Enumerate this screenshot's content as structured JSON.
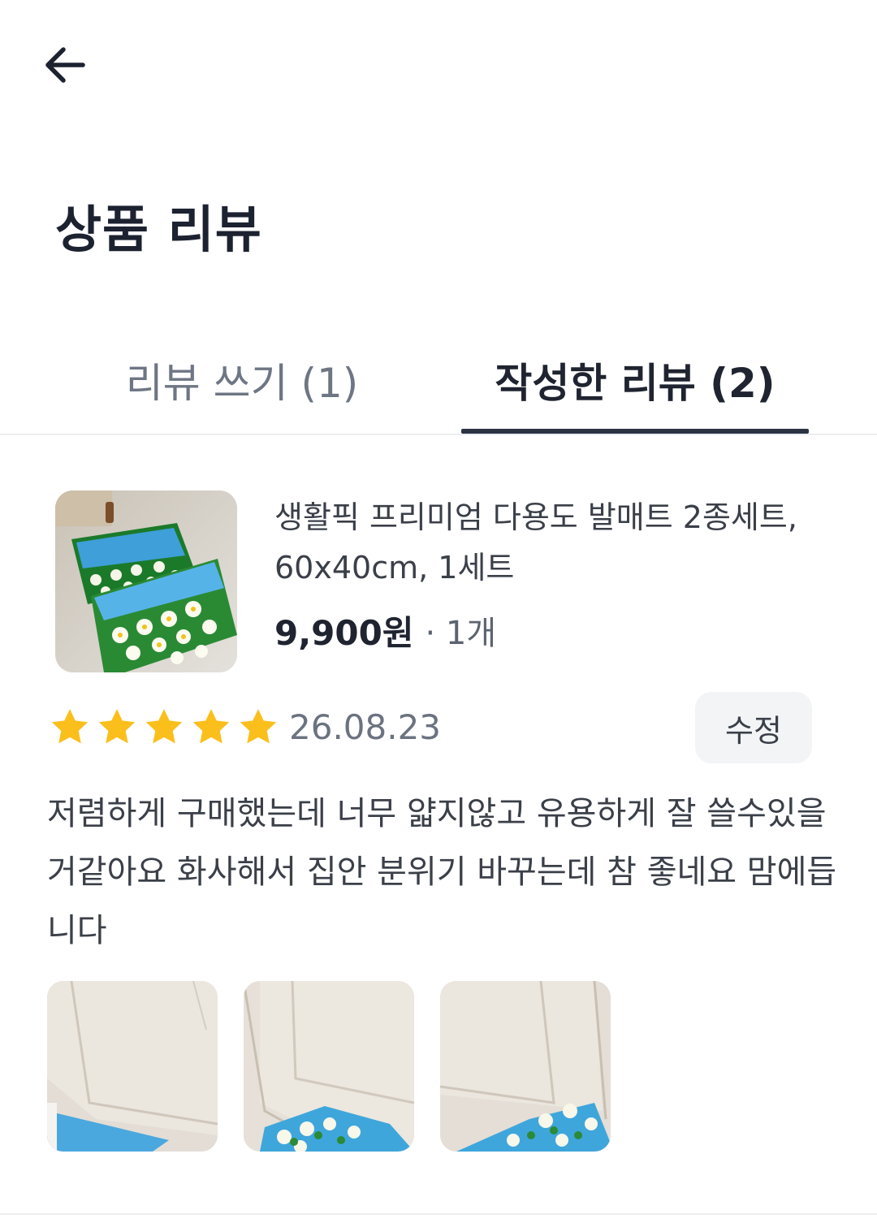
{
  "header": {
    "back_icon": "arrow-left-icon",
    "title": "상품 리뷰"
  },
  "tabs": [
    {
      "label": "리뷰 쓰기 (1)",
      "selected": false
    },
    {
      "label": "작성한 리뷰 (2)",
      "selected": true
    }
  ],
  "review": {
    "product": {
      "name": "생활픽 프리미엄 다용도 발매트 2종세트, 60x40cm, 1세트",
      "price": "9,900원",
      "quantity": "· 1개",
      "thumbnail_icon": "product-thumbnail"
    },
    "rating": 5,
    "rating_max": 5,
    "date": "26.08.23",
    "edit_label": "수정",
    "text": "저렴하게 구매했는데 너무 얇지않고 유용하게 잘 쓸수있을거같아요 화사해서 집안 분위기 바꾸는데 참 좋네요 맘에듭니다",
    "photos": [
      "review-photo-1",
      "review-photo-2",
      "review-photo-3"
    ]
  },
  "colors": {
    "star": "#fbbf1c",
    "tab_indicator": "#2c3444",
    "edit_button_bg": "#f2f4f6"
  }
}
